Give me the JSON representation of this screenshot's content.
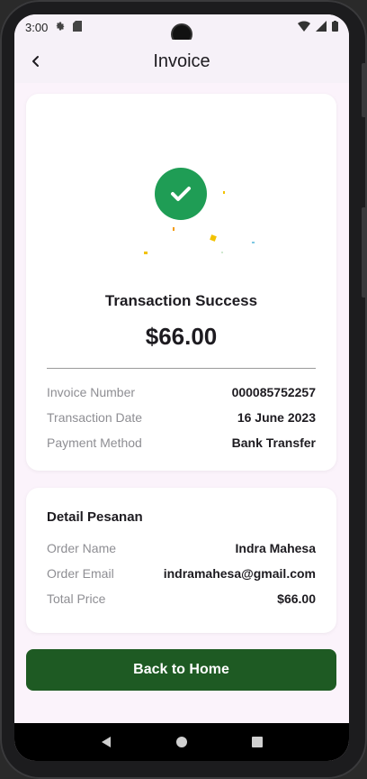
{
  "status_bar": {
    "time": "3:00",
    "icons": [
      "settings-icon",
      "sd-card-icon",
      "wifi-icon",
      "signal-icon",
      "battery-icon"
    ]
  },
  "app_bar": {
    "title": "Invoice",
    "back_icon": "chevron-left-icon"
  },
  "transaction": {
    "status_icon": "check-circle-icon",
    "title": "Transaction Success",
    "amount": "$66.00",
    "rows": [
      {
        "label": "Invoice Number",
        "value": "000085752257"
      },
      {
        "label": "Transaction Date",
        "value": "16 June 2023"
      },
      {
        "label": "Payment Method",
        "value": "Bank Transfer"
      }
    ]
  },
  "order_detail": {
    "title": "Detail Pesanan",
    "rows": [
      {
        "label": "Order Name",
        "value": "Indra Mahesa"
      },
      {
        "label": "Order Email",
        "value": "indramahesa@gmail.com"
      },
      {
        "label": "Total Price",
        "value": "$66.00"
      }
    ]
  },
  "actions": {
    "back_home_label": "Back to Home"
  },
  "nav": {
    "back": "triangle-back-icon",
    "home": "circle-home-icon",
    "recents": "square-recents-icon"
  },
  "colors": {
    "accent_green": "#1f9d55",
    "button_green": "#1e5a23",
    "background": "#fbf3fb"
  }
}
